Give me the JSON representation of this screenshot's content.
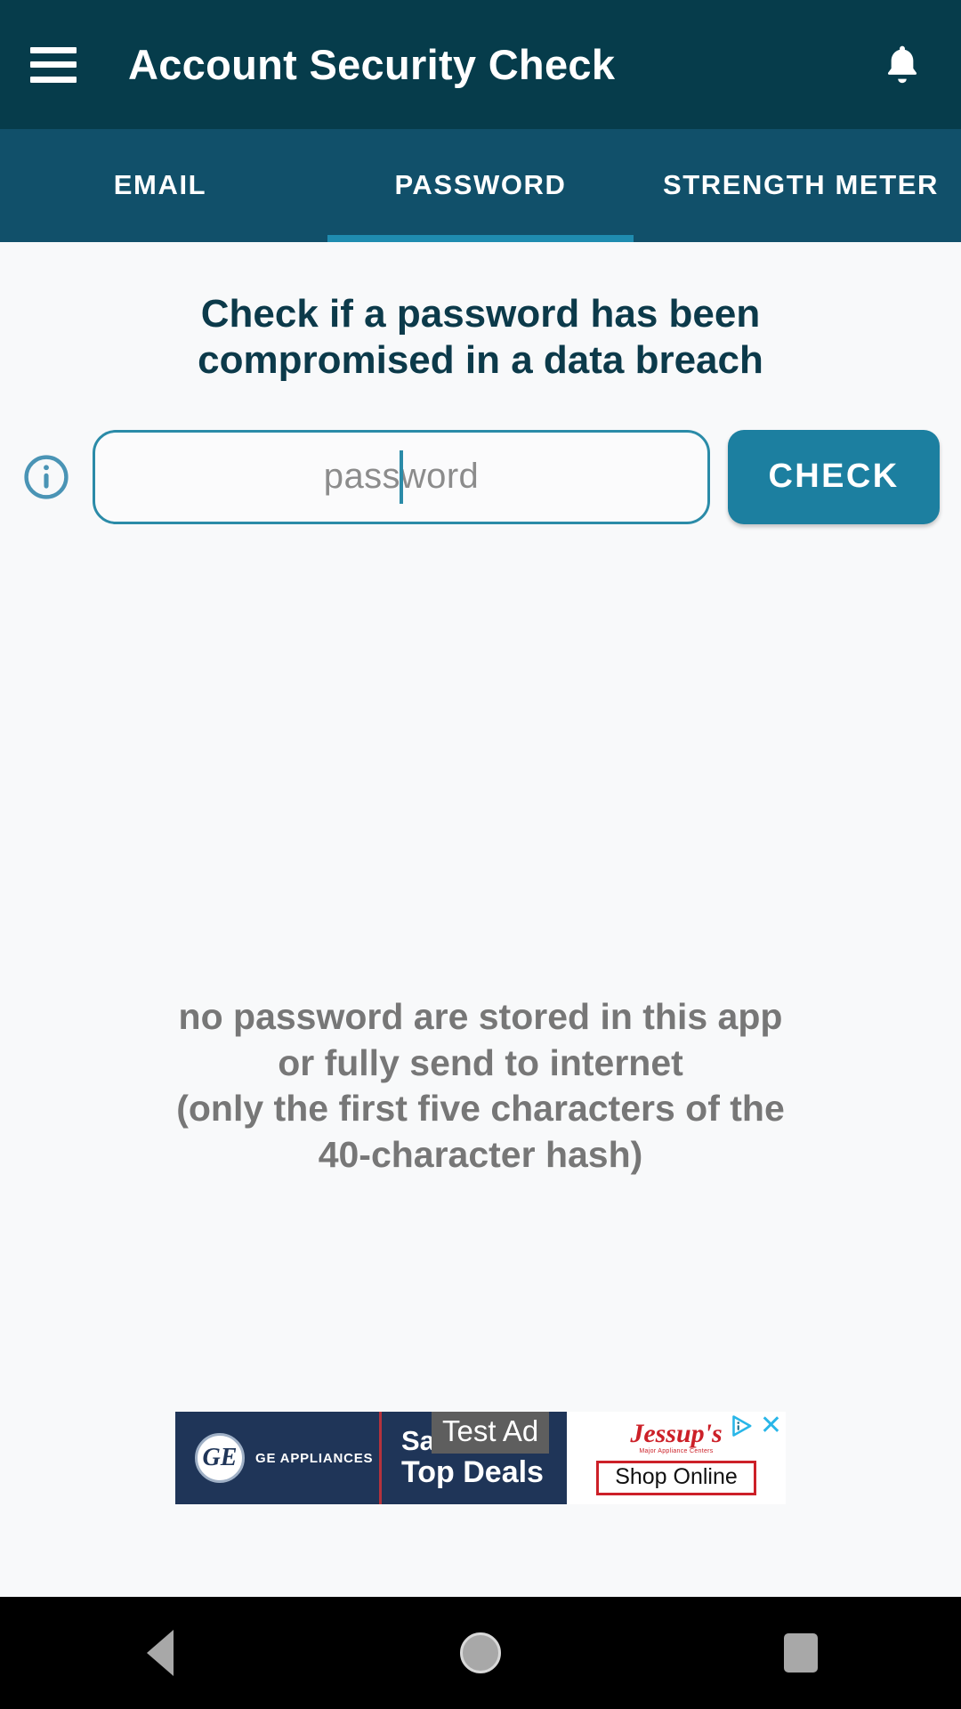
{
  "appbar": {
    "menu_icon": "hamburger-menu-icon",
    "title": "Account Security Check",
    "notification_icon": "bell-icon",
    "bg_color": "#063c4b"
  },
  "tabs": {
    "bg_color": "#11506a",
    "indicator_color": "#1f8cb0",
    "items": [
      {
        "label": "EMAIL",
        "active": false
      },
      {
        "label": "PASSWORD",
        "active": true
      },
      {
        "label": "STRENGTH METER",
        "active": false
      }
    ]
  },
  "main": {
    "headline": "Check if a password has been compromised in a data breach",
    "info_icon": "info-circle-icon",
    "password_input": {
      "placeholder": "password",
      "value": "",
      "border_color": "#2b8ba8",
      "caret_color": "#2b8ba8"
    },
    "check_button": {
      "label": "CHECK",
      "bg_color": "#1c7fa0"
    },
    "disclaimer": "no password are stored in this app or fully send to internet\n(only the first five characters of the 40-character hash)",
    "disclaimer_lines": [
      "no password are stored in this app",
      "or fully send to internet",
      "(only the first five characters of the",
      "40-character hash)"
    ],
    "disclaimer_color": "#777777",
    "bg_color": "#f8f9fa"
  },
  "ad": {
    "test_label": "Test Ad",
    "brand": "GE APPLIANCES",
    "brand_mark": "GE",
    "headline_line1": "Save On",
    "headline_line2": "Top Deals",
    "advertiser": "Jessup's",
    "advertiser_sub": "Major Appliance Centers",
    "cta": "Shop Online",
    "adchoices_icon": "adchoices-icon",
    "close_icon": "close-icon",
    "bg_color": "#1f3558"
  },
  "navbar": {
    "back_icon": "back-triangle-icon",
    "home_icon": "home-circle-icon",
    "recents_icon": "recents-square-icon",
    "bg_color": "#000000"
  }
}
